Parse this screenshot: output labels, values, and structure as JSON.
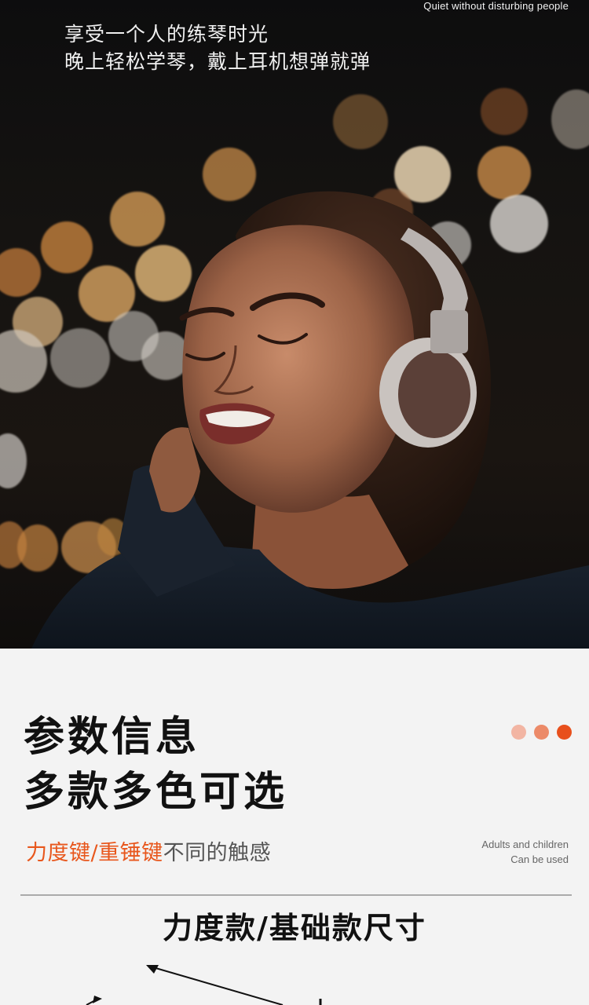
{
  "hero": {
    "tagline_en": "Quiet without disturbing people",
    "title_line1": "享受一个人的练琴时光",
    "title_line2": "晚上轻松学琴，戴上耳机想弹就弹"
  },
  "info": {
    "heading_line1": "参数信息",
    "heading_line2": "多款多色可选",
    "subline_accent": "力度键/重锤键",
    "subline_rest": "不同的触感",
    "adults_line1": "Adults and children",
    "adults_line2": "Can be used",
    "size_title": "力度款/基础款尺寸"
  },
  "colors": {
    "accent": "#e8571d",
    "dot1": "#f2b5a3",
    "dot2": "#ec8a68",
    "dot3": "#e8501c"
  }
}
